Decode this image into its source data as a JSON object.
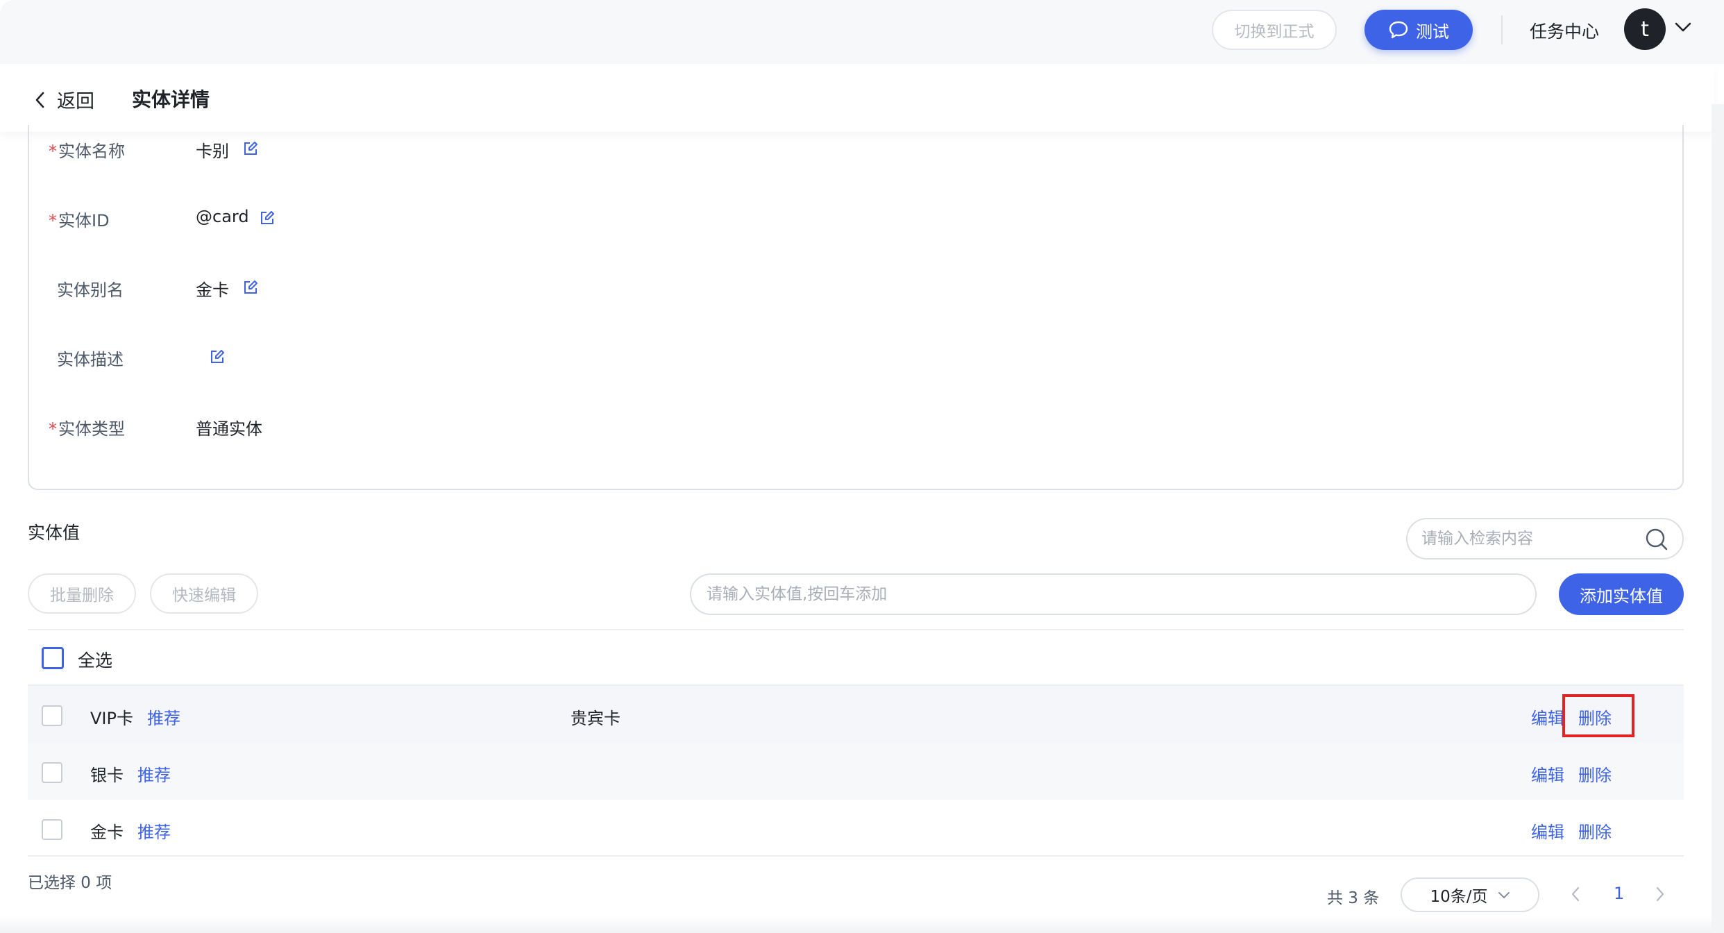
{
  "header": {
    "switch_label": "切换到正式",
    "test_label": "测试",
    "task_center": "任务中心",
    "avatar_letter": "t"
  },
  "subheader": {
    "back_label": "返回",
    "title": "实体详情"
  },
  "details": {
    "name": {
      "label": "实体名称",
      "value": "卡别",
      "required": "*"
    },
    "id": {
      "label": "实体ID",
      "value": "@card",
      "required": "*"
    },
    "alias": {
      "label": "实体别名",
      "value": "金卡"
    },
    "desc": {
      "label": "实体描述",
      "value": ""
    },
    "type": {
      "label": "实体类型",
      "value": "普通实体",
      "required": "*"
    }
  },
  "values_section": {
    "title": "实体值",
    "search_placeholder": "请输入检索内容",
    "batch_delete": "批量删除",
    "quick_edit": "快速编辑",
    "add_placeholder": "请输入实体值,按回车添加",
    "add_button": "添加实体值",
    "select_all": "全选",
    "rows": [
      {
        "name": "VIP卡",
        "tag": "推荐",
        "synonym": "贵宾卡",
        "edit": "编辑",
        "delete": "删除"
      },
      {
        "name": "银卡",
        "tag": "推荐",
        "synonym": "",
        "edit": "编辑",
        "delete": "删除"
      },
      {
        "name": "金卡",
        "tag": "推荐",
        "synonym": "",
        "edit": "编辑",
        "delete": "删除"
      }
    ]
  },
  "footer": {
    "selected": "已选择 0 项",
    "total": "共 3 条",
    "page_size": "10条/页",
    "current_page": "1"
  },
  "colors": {
    "primary": "#3e63e6",
    "required": "#e5484d",
    "highlight": "#e02424"
  }
}
